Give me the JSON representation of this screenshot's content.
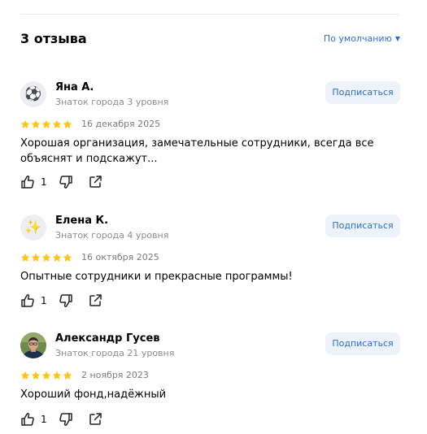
{
  "header": {
    "reviews_count": "3 отзыва",
    "sort_label": "По умолчанию"
  },
  "colors": {
    "accent": "#2a6fd4",
    "star": "#fcc419",
    "subscribe_bg": "#eef2fa"
  },
  "reviews": [
    {
      "author": "Яна А.",
      "level": "Знаток города 3 уровня",
      "avatar_icon": "soccer-ball-icon",
      "avatar_glyph": "⚽",
      "subscribe_label": "Подписаться",
      "rating": 5,
      "date": "16 декабря 2025",
      "text": "Хорошая организация, замечательные сотрудники, всегда все объяснят и подскажут...",
      "likes": "1"
    },
    {
      "author": "Елена К.",
      "level": "Знаток города 4 уровня",
      "avatar_icon": "sparkles-icon",
      "avatar_glyph": "✨",
      "subscribe_label": "Подписаться",
      "rating": 5,
      "date": "16 октября 2025",
      "text": "Опытные сотрудники и прекрасные программы!",
      "likes": "1"
    },
    {
      "author": "Александр Гусев",
      "level": "Знаток города 21 уровня",
      "avatar_icon": "user-photo-icon",
      "subscribe_label": "Подписаться",
      "rating": 5,
      "date": "2 ноября 2023",
      "text": "Хороший фонд,надёжный",
      "likes": "1"
    }
  ]
}
